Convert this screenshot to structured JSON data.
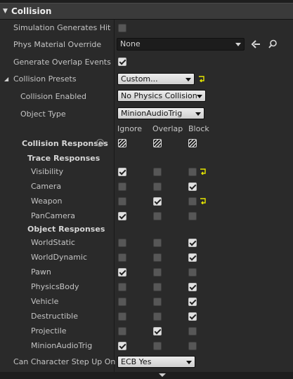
{
  "section": {
    "title": "Collision"
  },
  "simulation_generates_hit_events": {
    "label": "Simulation Generates Hit Events",
    "checked": false
  },
  "phys_material_override": {
    "label": "Phys Material Override",
    "value": "None"
  },
  "generate_overlap_events": {
    "label": "Generate Overlap Events",
    "checked": true
  },
  "collision_presets": {
    "label": "Collision Presets",
    "value": "Custom...",
    "collision_enabled": {
      "label": "Collision Enabled",
      "value": "No Physics Collision"
    },
    "object_type": {
      "label": "Object Type",
      "value": "MinionAudioTrig"
    },
    "columns": [
      "Ignore",
      "Overlap",
      "Block"
    ],
    "collision_responses_label": "Collision Responses",
    "trace_responses_label": "Trace Responses",
    "trace_responses": [
      {
        "name": "Visibility",
        "response": "ignore",
        "modified": true
      },
      {
        "name": "Camera",
        "response": "block",
        "modified": false
      },
      {
        "name": "Weapon",
        "response": "overlap",
        "modified": true
      },
      {
        "name": "PanCamera",
        "response": "ignore",
        "modified": false
      }
    ],
    "object_responses_label": "Object Responses",
    "object_responses": [
      {
        "name": "WorldStatic",
        "response": "block"
      },
      {
        "name": "WorldDynamic",
        "response": "block"
      },
      {
        "name": "Pawn",
        "response": "ignore"
      },
      {
        "name": "PhysicsBody",
        "response": "block"
      },
      {
        "name": "Vehicle",
        "response": "block"
      },
      {
        "name": "Destructible",
        "response": "block"
      },
      {
        "name": "Projectile",
        "response": "overlap"
      },
      {
        "name": "MinionAudioTrig",
        "response": "ignore"
      }
    ]
  },
  "can_character_step_up_on": {
    "label": "Can Character Step Up On",
    "value": "ECB Yes"
  },
  "colors": {
    "reset_arrow": "#e6e600",
    "panel": "#2a2a2a",
    "header": "#3a3a3a"
  }
}
